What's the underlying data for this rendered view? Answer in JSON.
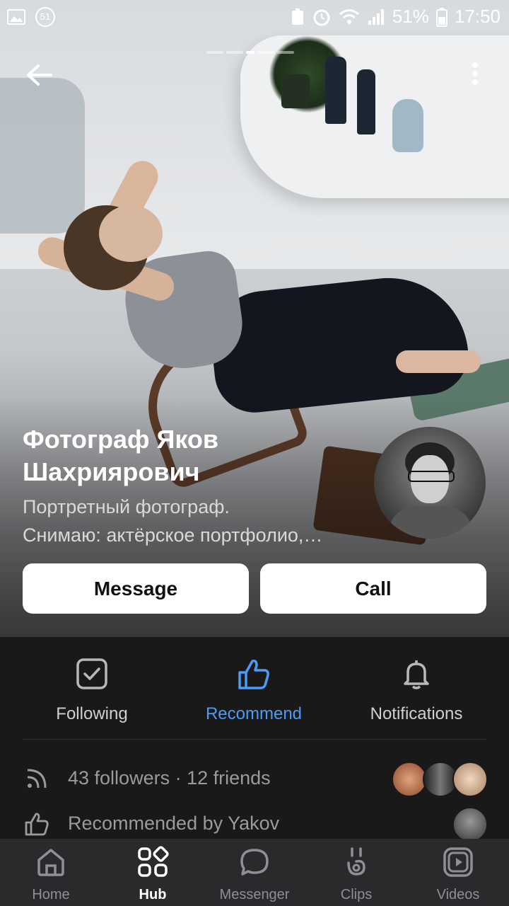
{
  "status_bar": {
    "battery": "51%",
    "time": "17:50",
    "notification_count": "51"
  },
  "profile": {
    "name_line1": "Фотограф Яков",
    "name_line2": "Шахриярович",
    "desc_line1": "Портретный фотограф.",
    "desc_line2": "Снимаю: актёрское портфолио,…",
    "photo_pager": {
      "total": 5,
      "active_index": 2
    }
  },
  "buttons": {
    "message": "Message",
    "call": "Call"
  },
  "actions": {
    "following": "Following",
    "recommend": "Recommend",
    "notifications": "Notifications"
  },
  "stats": {
    "followers": "43 followers · 12 friends",
    "recommended": "Recommended by Yakov"
  },
  "tabbar": {
    "home": "Home",
    "hub": "Hub",
    "messenger": "Messenger",
    "clips": "Clips",
    "videos": "Videos"
  },
  "colors": {
    "accent": "#4a9cf5",
    "background": "#19191a",
    "tabbar": "#2a2a2c"
  },
  "icons": [
    "back-arrow-icon",
    "more-icon",
    "checkbox-icon",
    "thumbs-up-icon",
    "bell-icon",
    "rss-icon",
    "home-icon",
    "hub-icon",
    "messenger-icon",
    "clips-icon",
    "videos-icon"
  ]
}
